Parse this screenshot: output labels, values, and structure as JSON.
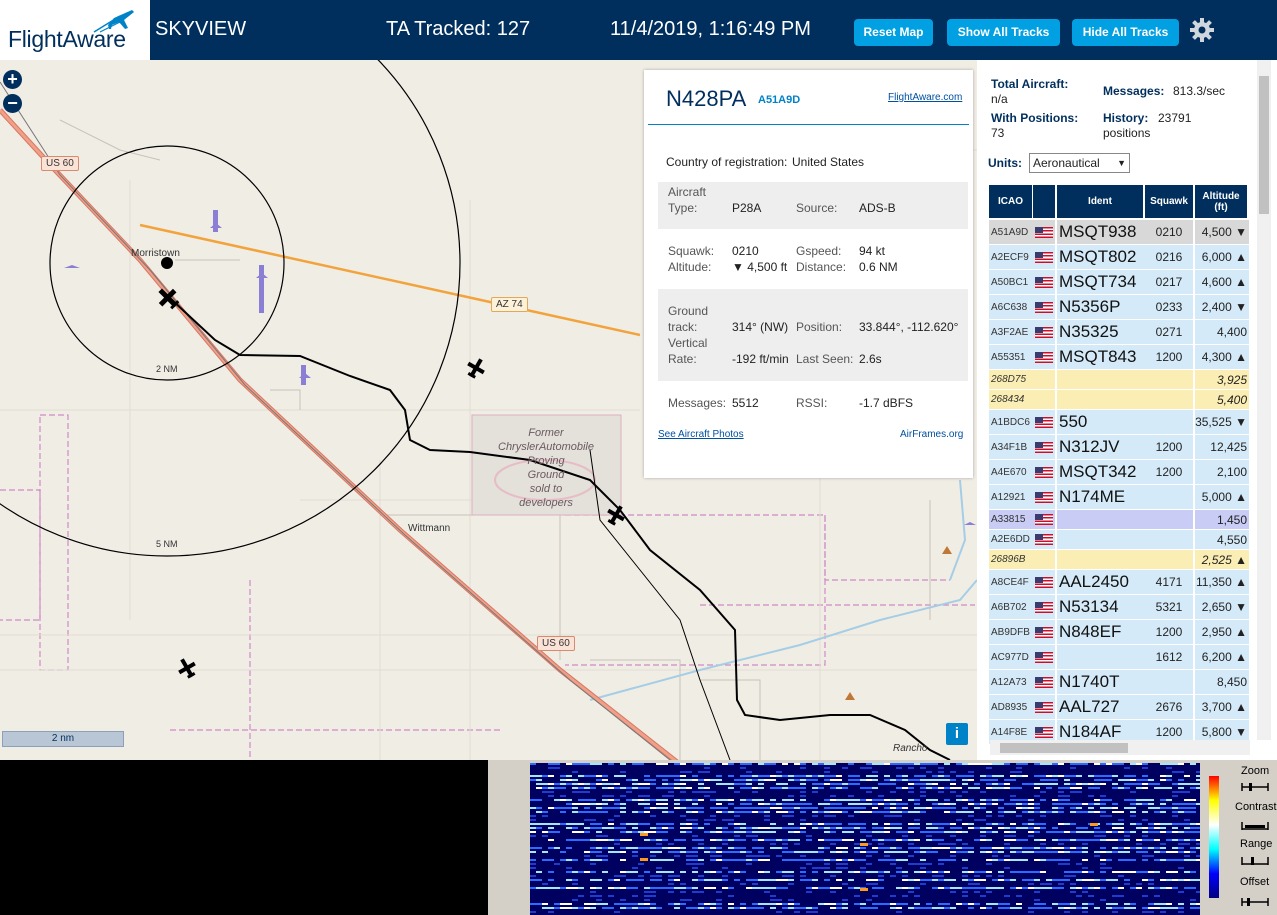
{
  "header": {
    "logo_text": "FlightAware",
    "app_name": "SKYVIEW",
    "tracked": "TA Tracked: 127",
    "datetime": "11/4/2019, 1:16:49 PM",
    "buttons": {
      "reset": "Reset Map",
      "show": "Show All Tracks",
      "hide": "Hide All Tracks"
    }
  },
  "map": {
    "zoom_in": "+",
    "zoom_out": "−",
    "labels": {
      "morristown": "Morristown",
      "wittmann": "Wittmann",
      "rancho": "Rancho",
      "ring2": "2 NM",
      "ring5": "5 NM",
      "us60a": "US 60",
      "us60b": "US 60",
      "az74": "AZ 74"
    },
    "chrysler": [
      "Former",
      "ChryslerAutomobile",
      "Proving",
      "Ground",
      "sold to",
      "developers"
    ],
    "scale": "2 nm",
    "info": "i"
  },
  "popup": {
    "callsign": "N428PA",
    "icao": "A51A9D",
    "fa_link": "FlightAware.com",
    "country_label": "Country of registration:",
    "country": "United States",
    "aircraft_label": "Aircraft",
    "type_label": "Type:",
    "type": "P28A",
    "source_label": "Source:",
    "source": "ADS-B",
    "squawk_label": "Squawk:",
    "squawk": "0210",
    "gspeed_label": "Gspeed:",
    "gspeed": "94 kt",
    "altitude_label": "Altitude:",
    "altitude": "▼ 4,500 ft",
    "distance_label": "Distance:",
    "distance": "0.6 NM",
    "gtrack_label_1": "Ground",
    "gtrack_label_2": "track:",
    "gtrack": "314° (NW)",
    "position_label": "Position:",
    "position": "33.844°, -112.620°",
    "vrate_label_1": "Vertical",
    "vrate_label_2": "Rate:",
    "vrate": "-192 ft/min",
    "lastseen_label": "Last Seen:",
    "lastseen": "2.6s",
    "messages_label": "Messages:",
    "messages": "5512",
    "rssi_label": "RSSI:",
    "rssi": "-1.7 dBFS",
    "photos_link": "See Aircraft Photos",
    "airframes_link": "AirFrames.org"
  },
  "sidebar": {
    "total_label": "Total Aircraft:",
    "total": "n/a",
    "messages_label": "Messages:",
    "messages": "813.3/sec",
    "positions_label": "With Positions:",
    "positions": "73",
    "history_label": "History:",
    "history": "23791 positions",
    "units_label": "Units:",
    "units": "Aeronautical",
    "columns": {
      "icao": "ICAO",
      "ident": "Ident",
      "squawk": "Squawk",
      "alt1": "Altitude",
      "alt2": "(ft)"
    },
    "rows": [
      {
        "icao": "A51A9D",
        "flag": true,
        "ident": "MSQT938",
        "squawk": "0210",
        "alt": "4,500 ▼",
        "style": "sel"
      },
      {
        "icao": "A2ECF9",
        "flag": true,
        "ident": "MSQT802",
        "squawk": "0216",
        "alt": "6,000 ▲",
        "style": "norm"
      },
      {
        "icao": "A50BC1",
        "flag": true,
        "ident": "MSQT734",
        "squawk": "0217",
        "alt": "4,600 ▲",
        "style": "norm"
      },
      {
        "icao": "A6C638",
        "flag": true,
        "ident": "N5356P",
        "squawk": "0233",
        "alt": "2,400 ▼",
        "style": "norm"
      },
      {
        "icao": "A3F2AE",
        "flag": true,
        "ident": "N35325",
        "squawk": "0271",
        "alt": "4,400",
        "style": "norm"
      },
      {
        "icao": "A55351",
        "flag": true,
        "ident": "MSQT843",
        "squawk": "1200",
        "alt": "4,300 ▲",
        "style": "norm"
      },
      {
        "icao": "268D75",
        "flag": false,
        "ident": "",
        "squawk": "",
        "alt": "3,925",
        "style": "yel",
        "short": true
      },
      {
        "icao": "268434",
        "flag": false,
        "ident": "",
        "squawk": "",
        "alt": "5,400",
        "style": "yel",
        "short": true
      },
      {
        "icao": "A1BDC6",
        "flag": true,
        "ident": "550",
        "squawk": "",
        "alt": "35,525 ▼",
        "style": "norm"
      },
      {
        "icao": "A34F1B",
        "flag": true,
        "ident": "N312JV",
        "squawk": "1200",
        "alt": "12,425",
        "style": "norm"
      },
      {
        "icao": "A4E670",
        "flag": true,
        "ident": "MSQT342",
        "squawk": "1200",
        "alt": "2,100",
        "style": "norm"
      },
      {
        "icao": "A12921",
        "flag": true,
        "ident": "N174ME",
        "squawk": "",
        "alt": "5,000 ▲",
        "style": "norm"
      },
      {
        "icao": "A33815",
        "flag": true,
        "ident": "",
        "squawk": "",
        "alt": "1,450",
        "style": "blu",
        "short": true
      },
      {
        "icao": "A2E6DD",
        "flag": true,
        "ident": "",
        "squawk": "",
        "alt": "4,550",
        "style": "norm",
        "short": true
      },
      {
        "icao": "26896B",
        "flag": false,
        "ident": "",
        "squawk": "",
        "alt": "2,525 ▲",
        "style": "yel",
        "short": true
      },
      {
        "icao": "A8CE4F",
        "flag": true,
        "ident": "AAL2450",
        "squawk": "4171",
        "alt": "11,350 ▲",
        "style": "norm"
      },
      {
        "icao": "A6B702",
        "flag": true,
        "ident": "N53134",
        "squawk": "5321",
        "alt": "2,650 ▼",
        "style": "norm"
      },
      {
        "icao": "AB9DFB",
        "flag": true,
        "ident": "N848EF",
        "squawk": "1200",
        "alt": "2,950 ▲",
        "style": "norm"
      },
      {
        "icao": "AC977D",
        "flag": true,
        "ident": "",
        "squawk": "1612",
        "alt": "6,200 ▲",
        "style": "norm"
      },
      {
        "icao": "A12A73",
        "flag": true,
        "ident": "N1740T",
        "squawk": "",
        "alt": "8,450",
        "style": "norm"
      },
      {
        "icao": "AD8935",
        "flag": true,
        "ident": "AAL727",
        "squawk": "2676",
        "alt": "3,700 ▲",
        "style": "norm"
      },
      {
        "icao": "A14F8E",
        "flag": true,
        "ident": "N184AF",
        "squawk": "1200",
        "alt": "5,800 ▼",
        "style": "norm"
      }
    ]
  },
  "spectrum": {
    "controls": {
      "zoom": "Zoom",
      "contrast": "Contrast",
      "range": "Range",
      "offset": "Offset"
    }
  }
}
